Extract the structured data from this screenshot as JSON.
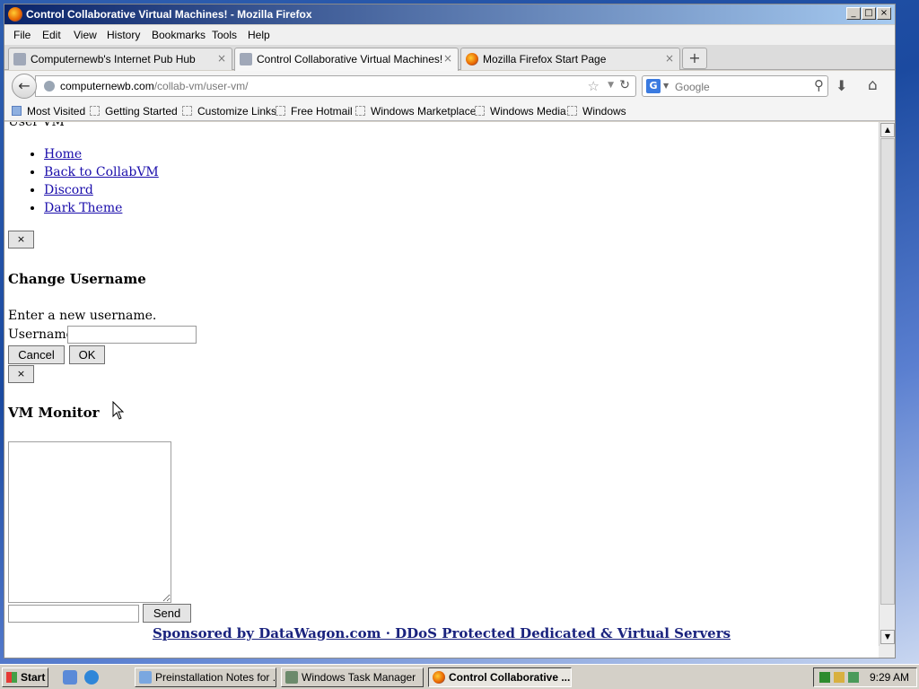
{
  "window": {
    "title": "Control Collaborative Virtual Machines! - Mozilla Firefox",
    "controls": {
      "minimize": "_",
      "maximize": "□",
      "close": "×"
    }
  },
  "menu": [
    "File",
    "Edit",
    "View",
    "History",
    "Bookmarks",
    "Tools",
    "Help"
  ],
  "tabs": [
    {
      "label": "Computernewb's Internet Pub Hub",
      "close": "×",
      "icon": "computer-icon"
    },
    {
      "label": "Control Collaborative Virtual Machines!",
      "close": "×",
      "icon": "computer-icon",
      "active": true
    },
    {
      "label": "Mozilla Firefox Start Page",
      "close": "×",
      "icon": "firefox-icon"
    }
  ],
  "new_tab": "+",
  "urlbar": {
    "host": "computernewb.com",
    "path": "/collab-vm/user-vm/"
  },
  "search": {
    "placeholder": "Google",
    "engine": "G"
  },
  "bookmarks": [
    "Most Visited",
    "Getting Started",
    "Customize Links",
    "Free Hotmail",
    "Windows Marketplace",
    "Windows Media",
    "Windows"
  ],
  "page": {
    "cut_text": "User VM",
    "nav": [
      "Home",
      "Back to CollabVM",
      "Discord",
      "Dark Theme"
    ],
    "close_x": "×",
    "change_username_title": "Change Username",
    "change_username_prompt": "Enter a new username.",
    "username_label": "Username",
    "username_value": "",
    "cancel_label": "Cancel",
    "ok_label": "OK",
    "vm_monitor_title": "VM Monitor",
    "chat_value": "",
    "send_label": "Send",
    "sponsor_text": "Sponsored by DataWagon.com · DDoS Protected Dedicated & Virtual Servers"
  },
  "taskbar": {
    "start": "Start",
    "tasks": [
      "Preinstallation Notes for ...",
      "Windows Task Manager",
      "Control Collaborative ..."
    ],
    "clock": "9:29 AM"
  },
  "colors": {
    "title_start": "#0a246a",
    "title_end": "#a6caf0",
    "link": "#1a0dab",
    "sponsor": "#1a237e"
  }
}
